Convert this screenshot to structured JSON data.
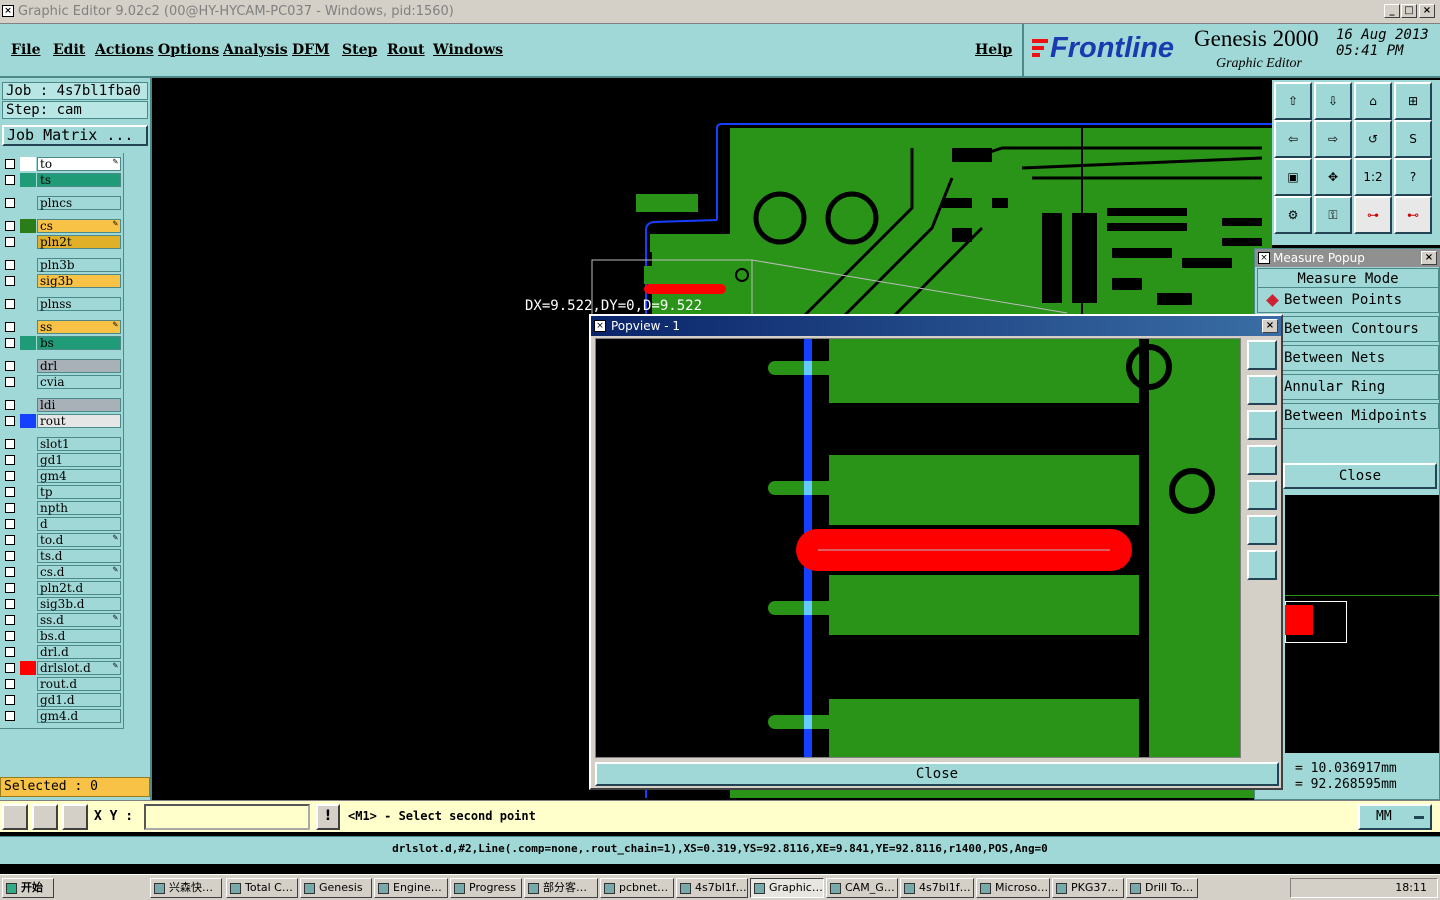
{
  "window": {
    "title": "Graphic Editor 9.02c2 (00@HY-HYCAM-PC037 - Windows, pid:1560)",
    "btn_min": "_",
    "btn_max": "□",
    "btn_close": "×"
  },
  "menu": [
    "File",
    "Edit",
    "Actions",
    "Options",
    "Analysis",
    "DFM",
    "Step",
    "Rout",
    "Windows"
  ],
  "help": "Help",
  "brand": {
    "logo": "Frontline",
    "product": "Genesis 2000",
    "sub": "Graphic Editor",
    "date": "16 Aug 2013",
    "time": "05:41 PM"
  },
  "job": {
    "job": "Job : 4s7bl1fba0",
    "step": "Step: cam",
    "matrix": "Job Matrix ..."
  },
  "layers": [
    {
      "name": "to",
      "color": "#ffffff",
      "bg": "#ffffff",
      "aff": true
    },
    {
      "name": "ts",
      "color": "#1f9b78",
      "bg": "#1f9b78",
      "aff": false
    },
    {
      "name": "plncs",
      "color": "#9fd8d6",
      "bg": "#9fd8d6",
      "aff": false
    },
    {
      "name": "cs",
      "color": "#2a7d18",
      "bg": "#f7c245",
      "aff": true
    },
    {
      "name": "pln2t",
      "color": "#9fd8d6",
      "bg": "#e0b028",
      "aff": false
    },
    {
      "name": "pln3b",
      "color": "#9fd8d6",
      "bg": "#9fd8d6",
      "aff": false
    },
    {
      "name": "sig3b",
      "color": "#9fd8d6",
      "bg": "#f7c245",
      "aff": false
    },
    {
      "name": "plnss",
      "color": "#9fd8d6",
      "bg": "#9fd8d6",
      "aff": false
    },
    {
      "name": "ss",
      "color": "#9fd8d6",
      "bg": "#f7c245",
      "aff": true
    },
    {
      "name": "bs",
      "color": "#1f9b78",
      "bg": "#1f9b78",
      "aff": false
    },
    {
      "name": "drl",
      "color": "#9fd8d6",
      "bg": "#a8b0b8",
      "aff": false
    },
    {
      "name": "cvia",
      "color": "#9fd8d6",
      "bg": "#9fd8d6",
      "aff": false
    },
    {
      "name": "ldi",
      "color": "#9fd8d6",
      "bg": "#a8b0b8",
      "aff": false
    },
    {
      "name": "rout",
      "color": "#1640ff",
      "bg": "#e6e6e6",
      "aff": false
    },
    {
      "name": "slot1",
      "color": "#9fd8d6",
      "bg": "#9fd8d6",
      "aff": false
    },
    {
      "name": "gd1",
      "color": "#9fd8d6",
      "bg": "#9fd8d6",
      "aff": false
    },
    {
      "name": "gm4",
      "color": "#9fd8d6",
      "bg": "#9fd8d6",
      "aff": false
    },
    {
      "name": "tp",
      "color": "#9fd8d6",
      "bg": "#9fd8d6",
      "aff": false
    },
    {
      "name": "npth",
      "color": "#9fd8d6",
      "bg": "#9fd8d6",
      "aff": false
    },
    {
      "name": "d",
      "color": "#9fd8d6",
      "bg": "#9fd8d6",
      "aff": false
    },
    {
      "name": "to.d",
      "color": "#9fd8d6",
      "bg": "#9fd8d6",
      "aff": true
    },
    {
      "name": "ts.d",
      "color": "#9fd8d6",
      "bg": "#9fd8d6",
      "aff": false
    },
    {
      "name": "cs.d",
      "color": "#9fd8d6",
      "bg": "#9fd8d6",
      "aff": true
    },
    {
      "name": "pln2t.d",
      "color": "#9fd8d6",
      "bg": "#9fd8d6",
      "aff": false
    },
    {
      "name": "sig3b.d",
      "color": "#9fd8d6",
      "bg": "#9fd8d6",
      "aff": false
    },
    {
      "name": "ss.d",
      "color": "#9fd8d6",
      "bg": "#9fd8d6",
      "aff": true
    },
    {
      "name": "bs.d",
      "color": "#9fd8d6",
      "bg": "#9fd8d6",
      "aff": false
    },
    {
      "name": "drl.d",
      "color": "#9fd8d6",
      "bg": "#9fd8d6",
      "aff": false
    },
    {
      "name": "drlslot.d",
      "color": "#ff0000",
      "bg": "#9fd8d6",
      "aff": true
    },
    {
      "name": "rout.d",
      "color": "#9fd8d6",
      "bg": "#9fd8d6",
      "aff": false
    },
    {
      "name": "gd1.d",
      "color": "#9fd8d6",
      "bg": "#9fd8d6",
      "aff": false
    },
    {
      "name": "gm4.d",
      "color": "#9fd8d6",
      "bg": "#9fd8d6",
      "aff": false
    }
  ],
  "selected": "Selected : 0",
  "measure_text": "DX=9.522,DY=0,D=9.522",
  "measure_popup": {
    "title": "Measure Popup",
    "mode": "Measure Mode",
    "options": [
      "Between Points",
      "Between Contours",
      "Between Nets",
      "Annular Ring",
      "Between Midpoints"
    ],
    "close": "Close",
    "x_readout": "= 10.036917mm",
    "y_readout": "= 92.268595mm"
  },
  "popview": {
    "title": "Popview - 1",
    "close": "Close"
  },
  "cmd": {
    "xy_label": "X Y :",
    "xy_value": "",
    "prompt": "<M1> - Select second point",
    "unit": "MM"
  },
  "status": "drlslot.d,#2,Line(.comp=none,.rout_chain=1),XS=0.319,YS=92.8116,XE=9.841,YE=92.8116,r1400,POS,Ang=0",
  "taskbar": {
    "start": "开始",
    "clock": "18:11",
    "tasks": [
      "兴森快…",
      "Total C…",
      "Genesis",
      "Engine…",
      "Progress",
      "部分客…",
      "pcbnet…",
      "4s7bl1f…",
      "Graphic…",
      "CAM_G…",
      "4s7bl1f…",
      "Microso…",
      "PKG37…",
      "Drill To…"
    ]
  },
  "colors": {
    "panel": "#9fd8d6",
    "copper": "#2a9418",
    "drill": "#ff0000",
    "rout": "#1640ff"
  }
}
